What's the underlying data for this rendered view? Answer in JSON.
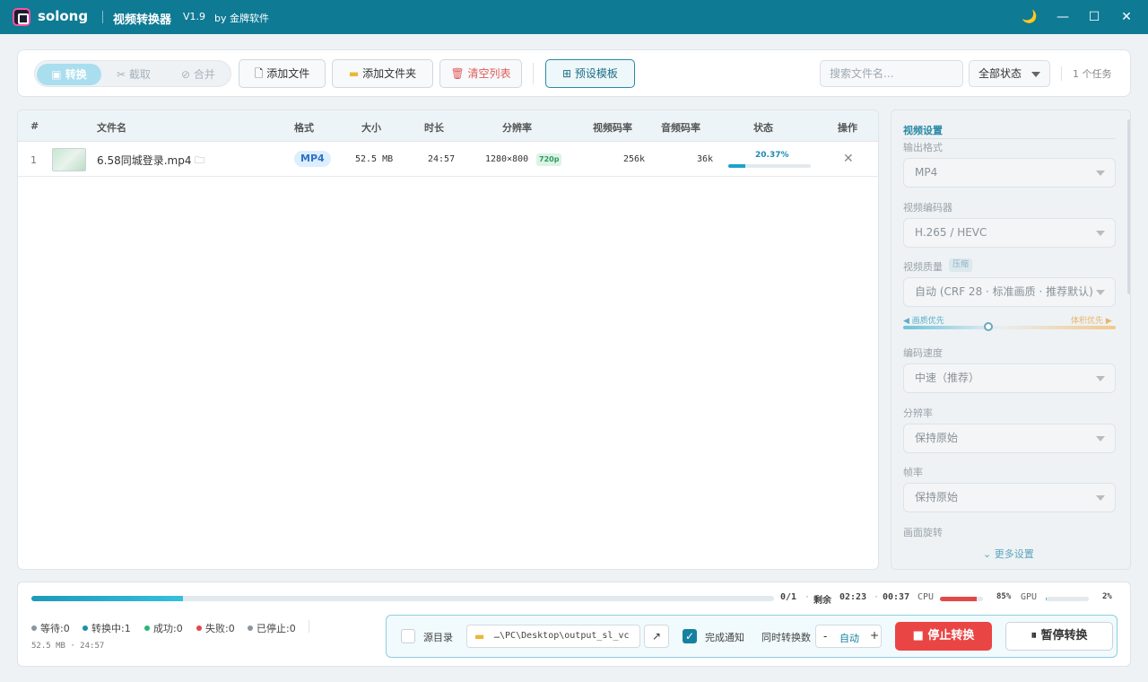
{
  "title_bar": {
    "app_name": "solong",
    "title": "视频转换器",
    "version": "V1.9",
    "by": "by 金牌软件",
    "icons": [
      "moon-icon",
      "minimize-icon",
      "maximize-icon",
      "close-icon"
    ]
  },
  "toolbar": {
    "modes": [
      {
        "label": "转换",
        "icon": "convert-icon",
        "active": true
      },
      {
        "label": "截取",
        "icon": "scissors-icon",
        "active": false
      },
      {
        "label": "合并",
        "icon": "link-icon",
        "active": false
      }
    ],
    "add_file": "添加文件",
    "add_folder": "添加文件夹",
    "clear_list": "清空列表",
    "preset": "预设模板",
    "search_placeholder": "搜索文件名...",
    "status_filter": "全部状态",
    "task_count": "1 个任务"
  },
  "file_list": {
    "columns": [
      "#",
      "文件名",
      "格式",
      "大小",
      "时长",
      "分辨率",
      "视频码率",
      "音频码率",
      "状态",
      "操作"
    ],
    "rows": [
      {
        "index": "1",
        "name": "6.58同城登录.mp4",
        "format": "MP4",
        "size": "52.5 MB",
        "duration": "24:57",
        "resolution": "1280×800",
        "res_badge": "720p",
        "video_bitrate": "256k",
        "audio_bitrate": "36k",
        "progress_text": "20.37%",
        "progress": 20.37
      }
    ]
  },
  "settings": {
    "section_title": "视频设置",
    "output_format_label": "输出格式",
    "output_format": "MP4",
    "encoder_label": "视频编码器",
    "encoder": "H.265 / HEVC",
    "quality_label": "视频质量",
    "quality_tag": "压缩",
    "quality": "自动 (CRF 28 · 标准画质 · 推荐默认)",
    "quality_left": "◀ 画质优先",
    "quality_right": "体积优先 ▶",
    "quality_slider": 0.4,
    "speed_label": "编码速度",
    "speed": "中速（推荐）",
    "resolution_label": "分辨率",
    "resolution": "保持原始",
    "fps_label": "帧率",
    "fps": "保持原始",
    "rotate_label": "画面旋转",
    "more": "⌄ 更多设置"
  },
  "bottom": {
    "overall_progress": 20.37,
    "count_text": "0/1",
    "remaining_label": "剩余",
    "remaining": "02:23",
    "elapsed": "00:37",
    "cpu_label": "CPU",
    "cpu_value": "85%",
    "cpu_percent": 85,
    "gpu_label": "GPU",
    "gpu_value": "2%",
    "gpu_percent": 2,
    "counts": [
      {
        "label": "等待:0",
        "color": "#8a96a0"
      },
      {
        "label": "转换中:1",
        "color": "#1a8fb0"
      },
      {
        "label": "成功:0",
        "color": "#2bb673"
      },
      {
        "label": "失败:0",
        "color": "#e84545"
      },
      {
        "label": "已停止:0",
        "color": "#8a96a0"
      }
    ],
    "summary": "52.5 MB · 24:57",
    "source_dir_label": "源目录",
    "output_path": "…\\PC\\Desktop\\output_sl_vc",
    "notify_label": "完成通知",
    "concurrent_label": "同时转换数",
    "concurrent_value": "自动",
    "stop": "■ 停止转换",
    "pause": "⏸ 暂停转换"
  }
}
